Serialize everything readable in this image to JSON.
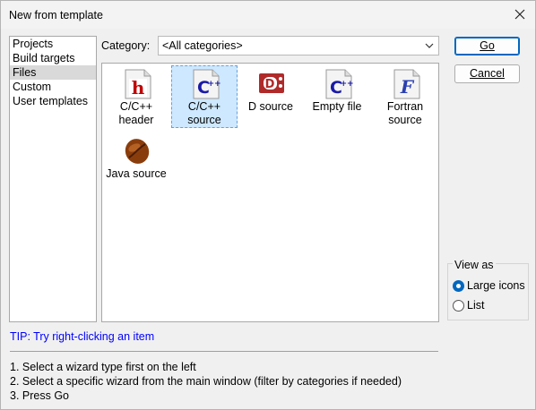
{
  "window": {
    "title": "New from template"
  },
  "categories_list": {
    "items": [
      "Projects",
      "Build targets",
      "Files",
      "Custom",
      "User templates"
    ],
    "selected": "Files"
  },
  "category_filter": {
    "label": "Category:",
    "value": "<All categories>"
  },
  "templates": [
    {
      "label": "C/C++ header",
      "icon": "c-header-file-icon",
      "selected": false
    },
    {
      "label": "C/C++ source",
      "icon": "cpp-source-file-icon",
      "selected": true
    },
    {
      "label": "D source",
      "icon": "d-source-file-icon",
      "selected": false
    },
    {
      "label": "Empty file",
      "icon": "empty-file-icon",
      "selected": false
    },
    {
      "label": "Fortran source",
      "icon": "fortran-source-file-icon",
      "selected": false
    },
    {
      "label": "Java source",
      "icon": "java-coffee-bean-icon",
      "selected": false
    }
  ],
  "buttons": {
    "go": "Go",
    "cancel": "Cancel"
  },
  "view_as": {
    "legend": "View as",
    "options": [
      "Large icons",
      "List"
    ],
    "selected": "Large icons"
  },
  "tip": "TIP: Try right-clicking an item",
  "instructions": [
    "1. Select a wizard type first on the left",
    "2. Select a specific wizard from the main window (filter by categories if needed)",
    "3. Press Go"
  ],
  "colors": {
    "tip_text": "#0000ff",
    "selection_bg": "#cde8ff",
    "accent": "#0067c0"
  }
}
